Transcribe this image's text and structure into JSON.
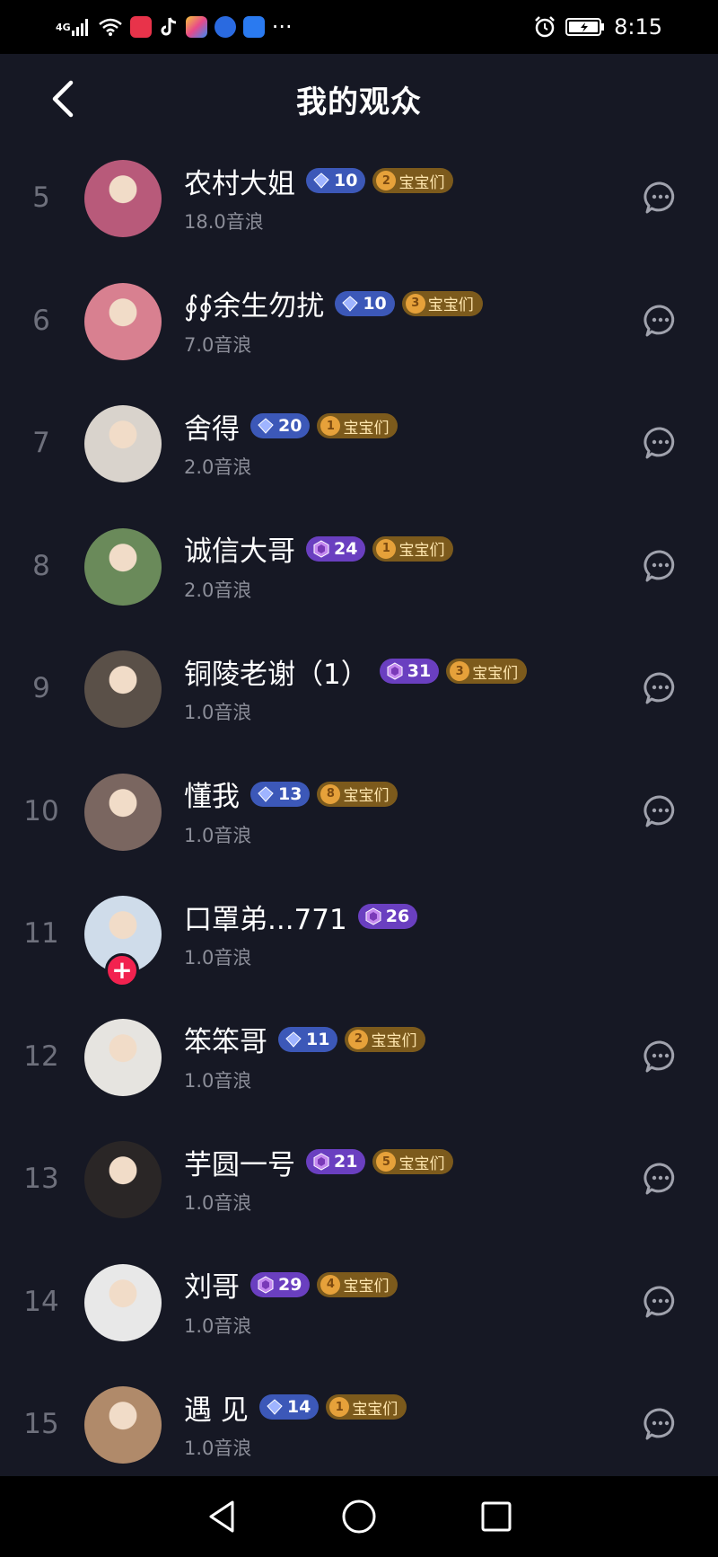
{
  "status_bar": {
    "network": "4G",
    "time": "8:15",
    "more": "···"
  },
  "header": {
    "title": "我的观众"
  },
  "colors": {
    "background": "#161824",
    "badge_blue": "#3c58b8",
    "badge_purple": "#6a3fc0",
    "group_badge": "#7c5a1c",
    "follow_red": "#f2224f"
  },
  "viewers": [
    {
      "rank": "5",
      "name": "农村大姐",
      "level": "10",
      "level_style": "blue",
      "heart": "2",
      "group": "宝宝们",
      "amount": "18.0音浪",
      "avatar_color": "#b85a7a",
      "followed": true
    },
    {
      "rank": "6",
      "name": "∮∮余生勿扰",
      "level": "10",
      "level_style": "blue",
      "heart": "3",
      "group": "宝宝们",
      "amount": "7.0音浪",
      "avatar_color": "#d88090",
      "followed": true
    },
    {
      "rank": "7",
      "name": "舍得",
      "level": "20",
      "level_style": "blue",
      "heart": "1",
      "group": "宝宝们",
      "amount": "2.0音浪",
      "avatar_color": "#d9d3cc",
      "followed": true
    },
    {
      "rank": "8",
      "name": "诚信大哥",
      "level": "24",
      "level_style": "purple",
      "heart": "1",
      "group": "宝宝们",
      "amount": "2.0音浪",
      "avatar_color": "#6a8a5a",
      "followed": true
    },
    {
      "rank": "9",
      "name": "铜陵老谢（1）",
      "level": "31",
      "level_style": "purple",
      "heart": "3",
      "group": "宝宝们",
      "amount": "1.0音浪",
      "avatar_color": "#5a5048",
      "followed": true
    },
    {
      "rank": "10",
      "name": "懂我",
      "level": "13",
      "level_style": "blue",
      "heart": "8",
      "group": "宝宝们",
      "amount": "1.0音浪",
      "avatar_color": "#7a6660",
      "followed": true
    },
    {
      "rank": "11",
      "name": "口罩弟...771",
      "level": "26",
      "level_style": "purple",
      "heart": "",
      "group": "",
      "amount": "1.0音浪",
      "avatar_color": "#cfdcea",
      "followed": false
    },
    {
      "rank": "12",
      "name": "笨笨哥",
      "level": "11",
      "level_style": "blue",
      "heart": "2",
      "group": "宝宝们",
      "amount": "1.0音浪",
      "avatar_color": "#e6e4e0",
      "followed": true
    },
    {
      "rank": "13",
      "name": "芋圆一号",
      "level": "21",
      "level_style": "purple",
      "heart": "5",
      "group": "宝宝们",
      "amount": "1.0音浪",
      "avatar_color": "#2a2626",
      "followed": true
    },
    {
      "rank": "14",
      "name": "刘哥",
      "level": "29",
      "level_style": "purple",
      "heart": "4",
      "group": "宝宝们",
      "amount": "1.0音浪",
      "avatar_color": "#e8e8e8",
      "followed": true
    },
    {
      "rank": "15",
      "name": "遇 见",
      "level": "14",
      "level_style": "blue",
      "heart": "1",
      "group": "宝宝们",
      "amount": "1.0音浪",
      "avatar_color": "#b08a6a",
      "followed": true
    }
  ],
  "icons": {
    "back": "chevron-left-icon",
    "message": "chat-bubble-icon",
    "nav_back": "triangle-back-icon",
    "nav_home": "circle-home-icon",
    "nav_recent": "square-recent-icon"
  }
}
